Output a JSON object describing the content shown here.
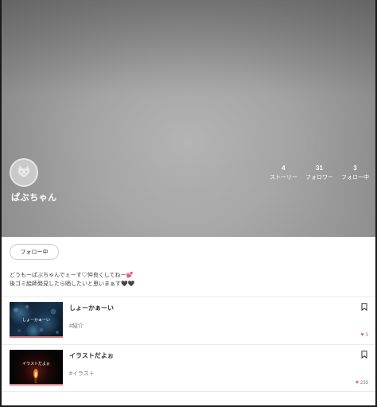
{
  "profile": {
    "username": "ぱぶちゃん",
    "stats": [
      {
        "value": "4",
        "label": "ストーリー"
      },
      {
        "value": "31",
        "label": "フォロワー"
      },
      {
        "value": "3",
        "label": "フォロー中"
      }
    ],
    "follow_button_label": "フォロー中",
    "bio_line1": "どうもーぱぶちゃんでぇーす♡仲良くしてねー💕",
    "bio_line2": "後ゴミ絵師発見したら晒したいと思いまぁす🖤🖤"
  },
  "stories": [
    {
      "title": "しょーかぁーい",
      "tag": "#紹介",
      "thumb_text": "しょーかぁーい",
      "likes": "0"
    },
    {
      "title": "イラストだよぉ",
      "tag": "#イラスト",
      "thumb_text": "イラストだよぉ",
      "likes": "233"
    }
  ],
  "colors": {
    "heart": "#e05a6a",
    "thumb_bar": "#e07a7a",
    "hero_gray": "#a4a4a4"
  }
}
